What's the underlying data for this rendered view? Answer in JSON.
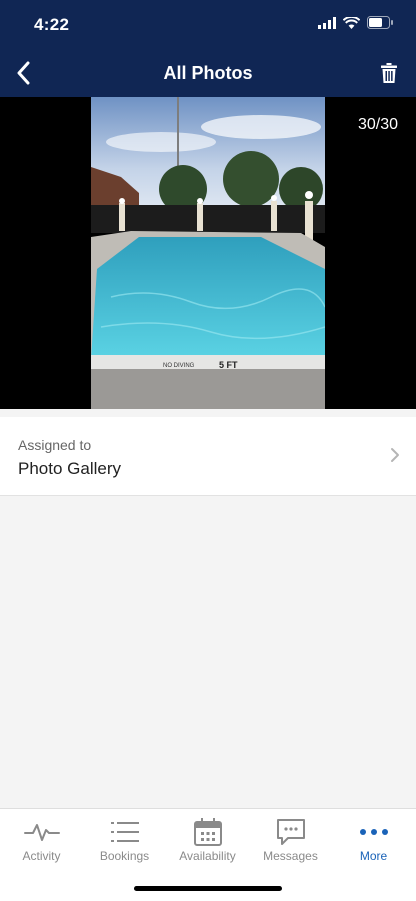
{
  "status_bar": {
    "time": "4:22"
  },
  "header": {
    "title": "All Photos"
  },
  "photo": {
    "counter": "30/30",
    "sign_left": "NO DIVING",
    "sign_right": "5 FT"
  },
  "assigned": {
    "caption": "Assigned to",
    "value": "Photo Gallery"
  },
  "tabs": [
    {
      "label": "Activity",
      "icon": "activity-icon"
    },
    {
      "label": "Bookings",
      "icon": "list-icon"
    },
    {
      "label": "Availability",
      "icon": "calendar-icon"
    },
    {
      "label": "Messages",
      "icon": "message-icon"
    },
    {
      "label": "More",
      "icon": "more-icon"
    }
  ],
  "colors": {
    "header_bg": "#102654",
    "active_tab": "#1a63b8",
    "inactive_tab": "#8a8a8a"
  }
}
